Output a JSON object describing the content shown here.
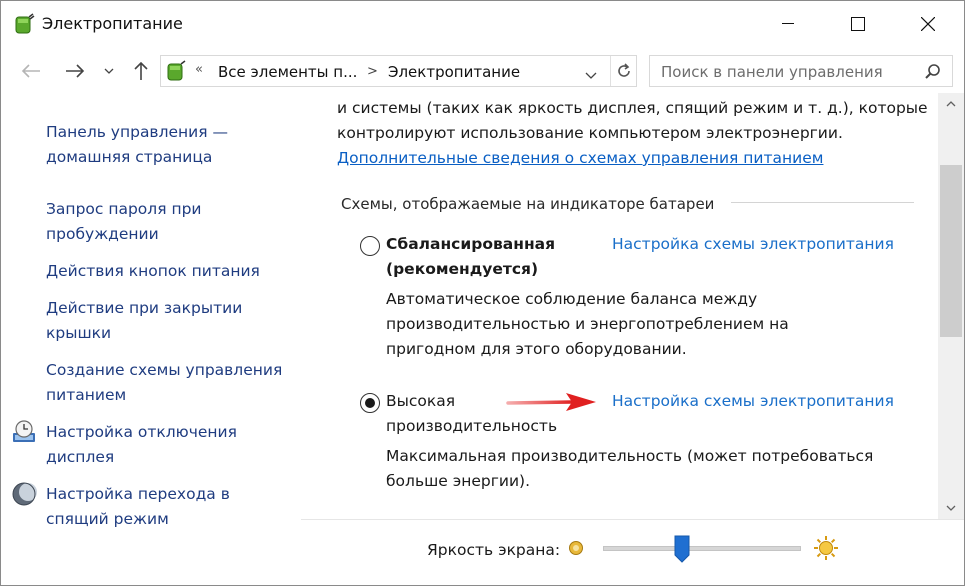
{
  "window": {
    "title": "Электропитание",
    "icon": "power-options-icon"
  },
  "address": {
    "crumb_separator": "«",
    "crumb_root": "Все элементы п...",
    "crumb_arrow": ">",
    "crumb_current": "Электропитание"
  },
  "search": {
    "placeholder": "Поиск в панели управления"
  },
  "sidebar": {
    "items": [
      {
        "line1": "Панель управления —",
        "line2": "домашняя страница"
      },
      {
        "line1": "Запрос пароля при",
        "line2": "пробуждении"
      },
      {
        "line1": "Действия кнопок питания",
        "line2": ""
      },
      {
        "line1": "Действие при закрытии",
        "line2": "крышки"
      },
      {
        "line1": "Создание схемы управления",
        "line2": "питанием"
      },
      {
        "line1": "Настройка отключения",
        "line2": "дисплея",
        "icon": "display-clock-icon"
      },
      {
        "line1": "Настройка перехода в",
        "line2": "спящий режим",
        "icon": "moon-icon"
      }
    ]
  },
  "main": {
    "intro_line1": "и системы (таких как яркость дисплея, спящий режим и т. д.), которые",
    "intro_line2": "контролируют использование компьютером электроэнергии.",
    "more_info_link": "Дополнительные сведения о схемах управления питанием",
    "section_title": "Схемы, отображаемые на индикаторе батареи",
    "plans": [
      {
        "name_line1": "Сбалансированная",
        "name_line2": "(рекомендуется)",
        "selected": false,
        "settings_link": "Настройка схемы электропитания",
        "desc_line1": "Автоматическое соблюдение баланса между",
        "desc_line2": "производительностью и энергопотреблением на",
        "desc_line3": "пригодном для этого оборудовании."
      },
      {
        "name_line1": "Высокая",
        "name_line2": "производительность",
        "selected": true,
        "settings_link": "Настройка схемы электропитания",
        "desc_line1": "Максимальная производительность (может потребоваться",
        "desc_line2": "больше энергии)."
      }
    ]
  },
  "brightness": {
    "label": "Яркость экрана:",
    "level_percent": 40
  },
  "colors": {
    "link": "#1a6fc9",
    "annotation_arrow": "#e02020",
    "slider_thumb": "#1f6fd1"
  }
}
